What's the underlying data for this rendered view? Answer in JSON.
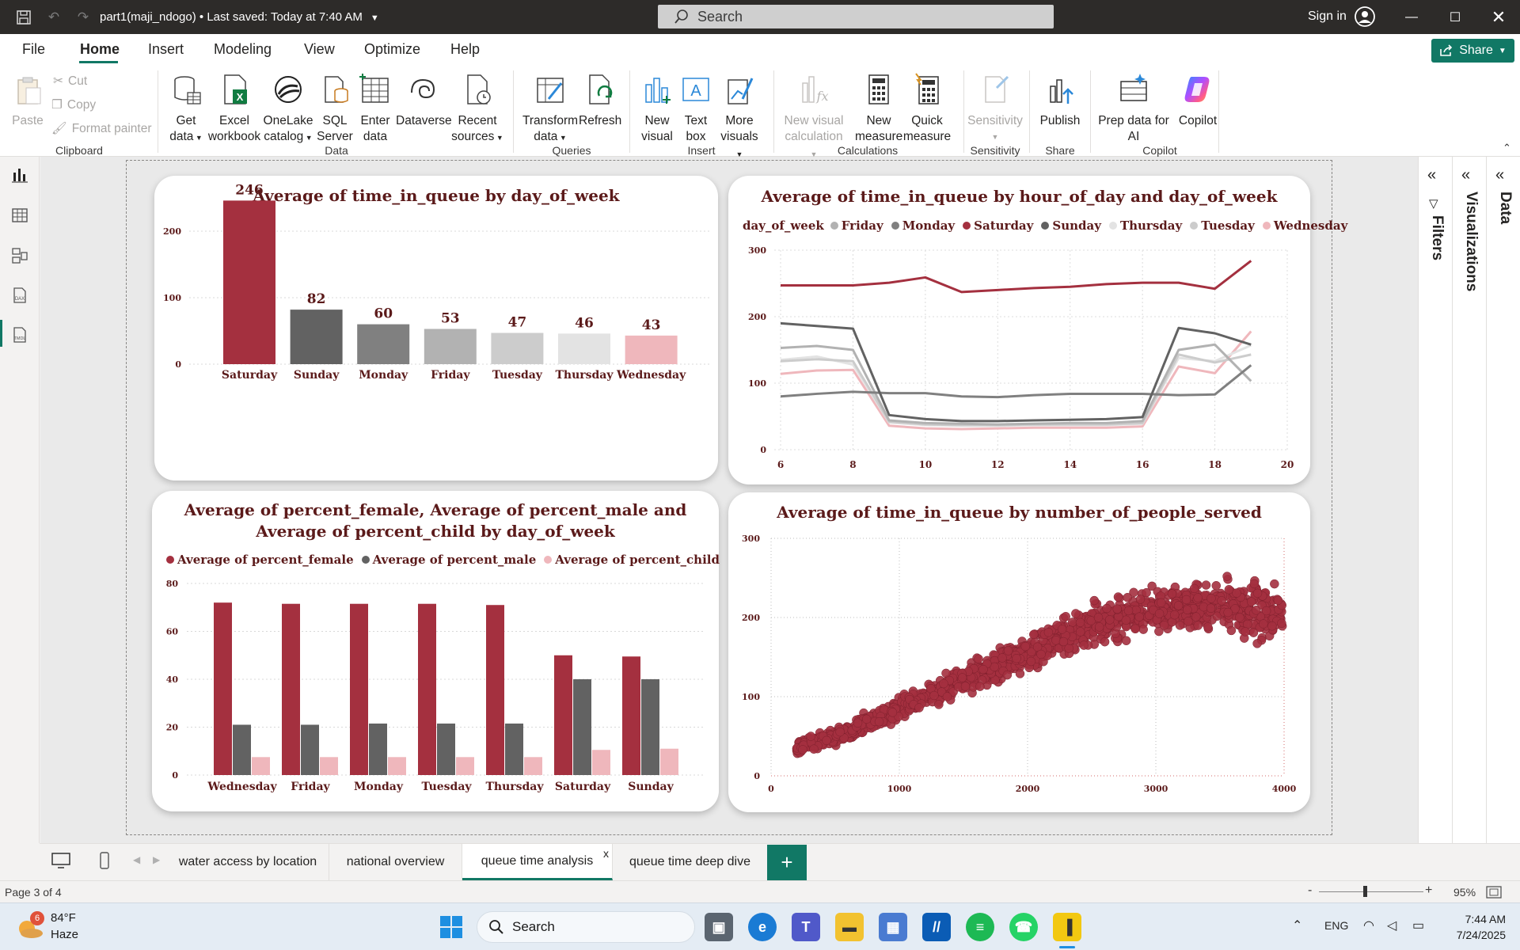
{
  "titlebar": {
    "title": "part1(maji_ndogo)",
    "saved": " • Last saved: Today at 7:40 AM",
    "search_placeholder": "Search",
    "signin": "Sign in"
  },
  "menu": {
    "items": [
      "File",
      "Home",
      "Insert",
      "Modeling",
      "View",
      "Optimize",
      "Help"
    ],
    "active": "Home",
    "share": "Share"
  },
  "ribbon": {
    "clipboard": {
      "paste": "Paste",
      "cut": "Cut",
      "copy": "Copy",
      "format_painter": "Format painter",
      "label": "Clipboard"
    },
    "data": {
      "get_data": [
        "Get",
        "data"
      ],
      "excel": [
        "Excel",
        "workbook"
      ],
      "onelake": [
        "OneLake",
        "catalog"
      ],
      "sql": [
        "SQL",
        "Server"
      ],
      "enter": [
        "Enter",
        "data"
      ],
      "dataverse": "Dataverse",
      "recent": [
        "Recent",
        "sources"
      ],
      "label": "Data"
    },
    "queries": {
      "transform": [
        "Transform",
        "data"
      ],
      "refresh": "Refresh",
      "label": "Queries"
    },
    "insert": {
      "new_visual": [
        "New",
        "visual"
      ],
      "text_box": [
        "Text",
        "box"
      ],
      "more_visuals": [
        "More",
        "visuals"
      ],
      "label": "Insert"
    },
    "calculations": {
      "new_visual_calc": [
        "New visual",
        "calculation"
      ],
      "new_measure": [
        "New",
        "measure"
      ],
      "quick_measure": [
        "Quick",
        "measure"
      ],
      "label": "Calculations"
    },
    "sensitivity": {
      "btn": "Sensitivity",
      "label": "Sensitivity"
    },
    "share": {
      "publish": "Publish",
      "label": "Share"
    },
    "copilot": {
      "prep": [
        "Prep data for",
        "AI"
      ],
      "copilot": "Copilot",
      "label": "Copilot"
    }
  },
  "panes": {
    "filters": "Filters",
    "visualizations": "Visualizations",
    "data": "Data"
  },
  "page_tabs": [
    "water access by location",
    "national overview",
    "queue time analysis",
    "queue time deep dive"
  ],
  "active_tab": "queue time analysis",
  "tab_close": "x",
  "add_tab": "+",
  "status": {
    "page": "Page 3 of 4",
    "zoom": "95%",
    "zoom_minus": "-",
    "zoom_plus": "+"
  },
  "taskbar": {
    "weather_temp": "84°F",
    "weather_desc": "Haze",
    "weather_badge": "6",
    "search": "Search",
    "lang": "ENG",
    "time": "7:44 AM",
    "date": "7/24/2025"
  },
  "colors": {
    "accent": "#117865",
    "saturday": "#a4303f",
    "sunday": "#626262",
    "monday": "#808080",
    "friday": "#b2b2b2",
    "tuesday": "#cccccc",
    "thursday": "#e3e3e3",
    "wednesday": "#efb7bc",
    "title": "#5b1a1a"
  },
  "chart_data": [
    {
      "type": "bar",
      "title": "Average of time_in_queue by day_of_week",
      "categories": [
        "Saturday",
        "Sunday",
        "Monday",
        "Friday",
        "Tuesday",
        "Thursday",
        "Wednesday"
      ],
      "values": [
        246,
        82,
        60,
        53,
        47,
        46,
        43
      ],
      "yticks": [
        "0",
        "100",
        "200"
      ],
      "ylim": [
        0,
        250
      ]
    },
    {
      "type": "line",
      "title": "Average of time_in_queue by hour_of_day and day_of_week",
      "legend_title": "day_of_week",
      "legend": [
        "Friday",
        "Monday",
        "Saturday",
        "Sunday",
        "Thursday",
        "Tuesday",
        "Wednesday"
      ],
      "x": [
        6,
        7,
        8,
        9,
        10,
        11,
        12,
        13,
        14,
        15,
        16,
        17,
        18,
        19
      ],
      "xticks": [
        "6",
        "8",
        "10",
        "12",
        "14",
        "16",
        "18",
        "20"
      ],
      "yticks": [
        "0",
        "100",
        "200",
        "300"
      ],
      "xlim": [
        6,
        20
      ],
      "ylim": [
        0,
        300
      ],
      "series": [
        {
          "name": "Saturday",
          "values": [
            247,
            247,
            247,
            251,
            259,
            237,
            240,
            243,
            245,
            249,
            251,
            251,
            242,
            284
          ]
        },
        {
          "name": "Sunday",
          "values": [
            190,
            186,
            182,
            52,
            46,
            43,
            43,
            44,
            45,
            46,
            49,
            183,
            175,
            158
          ]
        },
        {
          "name": "Monday",
          "values": [
            80,
            84,
            87,
            85,
            85,
            80,
            79,
            82,
            84,
            84,
            84,
            82,
            83,
            127
          ]
        },
        {
          "name": "Friday",
          "values": [
            153,
            156,
            150,
            44,
            40,
            39,
            38,
            39,
            40,
            40,
            43,
            150,
            158,
            103
          ]
        },
        {
          "name": "Tuesday",
          "values": [
            133,
            136,
            133,
            42,
            38,
            37,
            37,
            38,
            38,
            38,
            40,
            143,
            131,
            143
          ]
        },
        {
          "name": "Thursday",
          "values": [
            135,
            140,
            128,
            41,
            37,
            36,
            36,
            37,
            37,
            37,
            39,
            138,
            133,
            157
          ]
        },
        {
          "name": "Wednesday",
          "values": [
            114,
            119,
            120,
            36,
            32,
            31,
            32,
            33,
            33,
            33,
            35,
            125,
            115,
            178
          ]
        }
      ]
    },
    {
      "type": "bar",
      "title": "Average of percent_female, Average of percent_male and Average of percent_child by day_of_week",
      "categories": [
        "Wednesday",
        "Friday",
        "Monday",
        "Tuesday",
        "Thursday",
        "Saturday",
        "Sunday"
      ],
      "yticks": [
        "0",
        "20",
        "40",
        "60",
        "80"
      ],
      "ylim": [
        0,
        80
      ],
      "series": [
        {
          "name": "Average of percent_female",
          "values": [
            72,
            71.5,
            71.5,
            71.5,
            71,
            50,
            49.5
          ]
        },
        {
          "name": "Average of percent_male",
          "values": [
            21,
            21,
            21.5,
            21.5,
            21.5,
            40,
            40
          ]
        },
        {
          "name": "Average of percent_child",
          "values": [
            7.5,
            7.5,
            7.5,
            7.5,
            7.5,
            10.5,
            11
          ]
        }
      ]
    },
    {
      "type": "scatter",
      "title": "Average of time_in_queue by number_of_people_served",
      "xticks": [
        "0",
        "1000",
        "2000",
        "3000",
        "4000"
      ],
      "yticks": [
        "0",
        "100",
        "200",
        "300"
      ],
      "xlim": [
        0,
        4000
      ],
      "ylim": [
        0,
        300
      ],
      "trend": [
        [
          200,
          35
        ],
        [
          500,
          50
        ],
        [
          1000,
          85
        ],
        [
          1500,
          120
        ],
        [
          2000,
          155
        ],
        [
          2500,
          190
        ],
        [
          3000,
          210
        ],
        [
          3500,
          215
        ],
        [
          4000,
          205
        ]
      ]
    }
  ]
}
